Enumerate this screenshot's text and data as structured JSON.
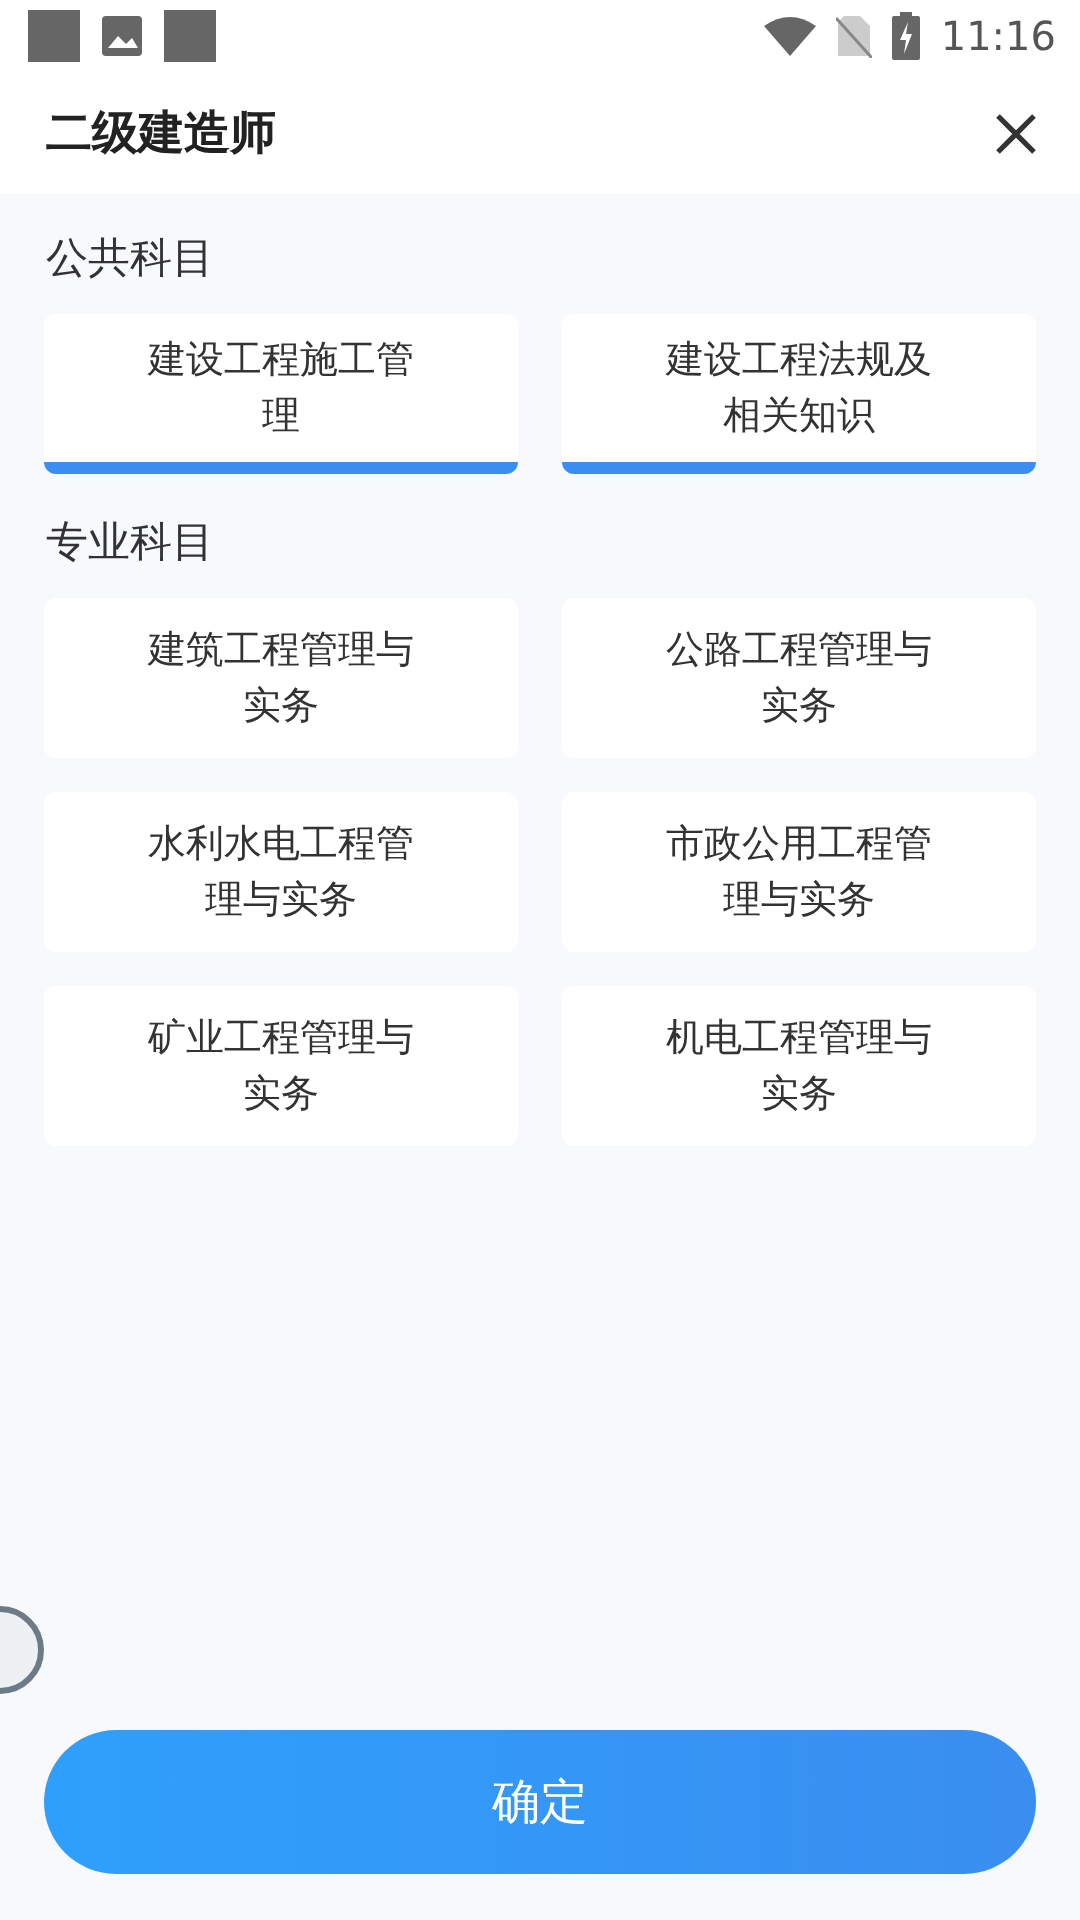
{
  "status_bar": {
    "time": "11:16"
  },
  "header": {
    "title": "二级建造师"
  },
  "sections": [
    {
      "title": "公共科目",
      "subjects": [
        {
          "label": "建设工程施工管理",
          "selected": true
        },
        {
          "label": "建设工程法规及相关知识",
          "selected": true
        }
      ]
    },
    {
      "title": "专业科目",
      "subjects": [
        {
          "label": "建筑工程管理与实务",
          "selected": false
        },
        {
          "label": "公路工程管理与实务",
          "selected": false
        },
        {
          "label": "水利水电工程管理与实务",
          "selected": false
        },
        {
          "label": "市政公用工程管理与实务",
          "selected": false
        },
        {
          "label": "矿业工程管理与实务",
          "selected": false
        },
        {
          "label": "机电工程管理与实务",
          "selected": false
        }
      ]
    }
  ],
  "confirm_button": {
    "label": "确定"
  }
}
